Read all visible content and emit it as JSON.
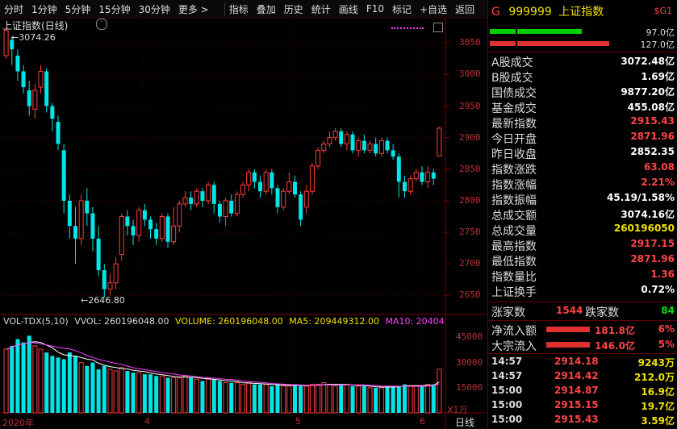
{
  "toolbar": {
    "items": [
      "分时",
      "1分钟",
      "5分钟",
      "15分钟",
      "30分钟",
      "更多 >",
      "指标",
      "叠加",
      "历史",
      "统计",
      "画线",
      "F10",
      "标记",
      "+自选",
      "返回"
    ]
  },
  "chart": {
    "title": "上证指数(日线)",
    "high_marker": "3074.26",
    "low_marker": "2646.80",
    "price_axis": [
      "3050",
      "3000",
      "2950",
      "2900",
      "2850",
      "2800",
      "2750",
      "2700",
      "2650"
    ],
    "vol_axis": [
      "45000",
      "30000",
      "15000"
    ],
    "vol_unit": "X1万",
    "date_labels": [
      "2020年",
      "4",
      "5",
      "6"
    ],
    "timeframe_button": "日线",
    "vol_header": {
      "indicator": "VOL-TDX(5,10)",
      "vvol": "VVOL: 260196048.00",
      "volume": "VOLUME: 260196048.00",
      "ma5": "MA5: 209449312.00",
      "ma10": "MA10: 20404"
    }
  },
  "chart_data": {
    "type": "candlestick",
    "title": "上证指数(日线)",
    "ylim": [
      2630,
      3090
    ],
    "candles": [
      [
        3030,
        3070,
        3025,
        3074
      ],
      [
        3055,
        3040,
        3015,
        3060
      ],
      [
        3030,
        3005,
        2990,
        3040
      ],
      [
        3005,
        2980,
        2970,
        3015
      ],
      [
        2975,
        2950,
        2935,
        2990
      ],
      [
        2945,
        2975,
        2930,
        2985
      ],
      [
        2980,
        3005,
        2970,
        3015
      ],
      [
        3005,
        2950,
        2940,
        3010
      ],
      [
        2950,
        2930,
        2910,
        2955
      ],
      [
        2925,
        2890,
        2880,
        2935
      ],
      [
        2880,
        2800,
        2780,
        2890
      ],
      [
        2800,
        2760,
        2740,
        2810
      ],
      [
        2760,
        2740,
        2700,
        2790
      ],
      [
        2740,
        2800,
        2730,
        2810
      ],
      [
        2800,
        2780,
        2760,
        2820
      ],
      [
        2780,
        2740,
        2720,
        2790
      ],
      [
        2740,
        2690,
        2680,
        2760
      ],
      [
        2690,
        2660,
        2646,
        2700
      ],
      [
        2660,
        2670,
        2650,
        2685
      ],
      [
        2670,
        2700,
        2660,
        2710
      ],
      [
        2715,
        2775,
        2705,
        2780
      ],
      [
        2775,
        2760,
        2745,
        2785
      ],
      [
        2760,
        2745,
        2730,
        2770
      ],
      [
        2745,
        2785,
        2735,
        2790
      ],
      [
        2785,
        2770,
        2760,
        2795
      ],
      [
        2770,
        2755,
        2740,
        2775
      ],
      [
        2755,
        2740,
        2730,
        2765
      ],
      [
        2740,
        2775,
        2735,
        2780
      ],
      [
        2775,
        2735,
        2725,
        2780
      ],
      [
        2735,
        2760,
        2730,
        2790
      ],
      [
        2760,
        2795,
        2750,
        2800
      ],
      [
        2795,
        2805,
        2790,
        2815
      ],
      [
        2805,
        2795,
        2785,
        2815
      ],
      [
        2795,
        2815,
        2790,
        2820
      ],
      [
        2815,
        2800,
        2790,
        2820
      ],
      [
        2800,
        2825,
        2795,
        2830
      ],
      [
        2825,
        2795,
        2780,
        2830
      ],
      [
        2795,
        2775,
        2765,
        2800
      ],
      [
        2775,
        2800,
        2760,
        2805
      ],
      [
        2800,
        2780,
        2775,
        2810
      ],
      [
        2780,
        2810,
        2775,
        2815
      ],
      [
        2810,
        2825,
        2805,
        2830
      ],
      [
        2825,
        2845,
        2815,
        2850
      ],
      [
        2845,
        2830,
        2820,
        2850
      ],
      [
        2830,
        2815,
        2805,
        2840
      ],
      [
        2815,
        2845,
        2810,
        2850
      ],
      [
        2845,
        2820,
        2810,
        2850
      ],
      [
        2820,
        2790,
        2780,
        2825
      ],
      [
        2790,
        2815,
        2785,
        2820
      ],
      [
        2815,
        2830,
        2810,
        2845
      ],
      [
        2830,
        2810,
        2805,
        2840
      ],
      [
        2810,
        2770,
        2760,
        2815
      ],
      [
        2790,
        2815,
        2780,
        2825
      ],
      [
        2815,
        2855,
        2810,
        2860
      ],
      [
        2855,
        2880,
        2850,
        2885
      ],
      [
        2880,
        2890,
        2875,
        2895
      ],
      [
        2890,
        2900,
        2885,
        2910
      ],
      [
        2900,
        2910,
        2895,
        2915
      ],
      [
        2910,
        2890,
        2885,
        2915
      ],
      [
        2890,
        2905,
        2880,
        2910
      ],
      [
        2905,
        2880,
        2875,
        2910
      ],
      [
        2880,
        2895,
        2870,
        2900
      ],
      [
        2895,
        2880,
        2875,
        2905
      ],
      [
        2880,
        2890,
        2875,
        2895
      ],
      [
        2890,
        2875,
        2870,
        2900
      ],
      [
        2875,
        2895,
        2870,
        2900
      ],
      [
        2895,
        2880,
        2875,
        2900
      ],
      [
        2880,
        2870,
        2865,
        2890
      ],
      [
        2870,
        2830,
        2805,
        2875
      ],
      [
        2830,
        2815,
        2805,
        2840
      ],
      [
        2815,
        2835,
        2810,
        2840
      ],
      [
        2835,
        2845,
        2830,
        2850
      ],
      [
        2845,
        2830,
        2825,
        2855
      ],
      [
        2830,
        2845,
        2820,
        2855
      ],
      [
        2845,
        2835,
        2825,
        2850
      ],
      [
        2871,
        2915,
        2871,
        2917
      ]
    ],
    "volumes": [
      38,
      40,
      44,
      42,
      46,
      40,
      38,
      36,
      34,
      33,
      32,
      36,
      34,
      30,
      28,
      30,
      26,
      28,
      26,
      25,
      27,
      25,
      24,
      24,
      23,
      23,
      22,
      22,
      21,
      21,
      21,
      22,
      21,
      20,
      19,
      20,
      20,
      19,
      18,
      18,
      18,
      17,
      18,
      17,
      17,
      17,
      16,
      17,
      16,
      16,
      17,
      16,
      16,
      17,
      17,
      18,
      17,
      16,
      17,
      17,
      16,
      16,
      16,
      15,
      15,
      15,
      16,
      16,
      16,
      17,
      16,
      16,
      16,
      17,
      17,
      26
    ]
  },
  "panel": {
    "header": {
      "code_prefix": "G",
      "code": "999999",
      "name": "上证指数",
      "tag": "$G1"
    },
    "bar_up_value": "97.0亿",
    "bar_down_value": "127.0亿",
    "stats": [
      {
        "k": "A股成交",
        "v": "3072.48亿",
        "c": "white"
      },
      {
        "k": "B股成交",
        "v": "1.69亿",
        "c": "white"
      },
      {
        "k": "国债成交",
        "v": "9877.20亿",
        "c": "white"
      },
      {
        "k": "基金成交",
        "v": "455.08亿",
        "c": "white"
      },
      {
        "k": "最新指数",
        "v": "2915.43",
        "c": "red"
      },
      {
        "k": "今日开盘",
        "v": "2871.96",
        "c": "red"
      },
      {
        "k": "昨日收盘",
        "v": "2852.35",
        "c": "white"
      },
      {
        "k": "指数涨跌",
        "v": "63.08",
        "c": "red"
      },
      {
        "k": "指数涨幅",
        "v": "2.21%",
        "c": "red"
      },
      {
        "k": "指数振幅",
        "v": "45.19/1.58%",
        "c": "white"
      },
      {
        "k": "总成交额",
        "v": "3074.16亿",
        "c": "white"
      },
      {
        "k": "总成交量",
        "v": "260196050",
        "c": "yellow"
      },
      {
        "k": "最高指数",
        "v": "2917.15",
        "c": "red"
      },
      {
        "k": "最低指数",
        "v": "2871.96",
        "c": "red"
      },
      {
        "k": "指数量比",
        "v": "1.36",
        "c": "red"
      },
      {
        "k": "上证换手",
        "v": "0.72%",
        "c": "white"
      }
    ],
    "rise_label": "涨家数",
    "rise_count": "1544",
    "fall_label": "跌家数",
    "fall_count": "84",
    "flows": [
      {
        "k": "净流入额",
        "v": "181.8亿",
        "pct": "6%"
      },
      {
        "k": "大宗流入",
        "v": "146.0亿",
        "pct": "5%"
      }
    ],
    "ticks": [
      {
        "t": "14:57",
        "p": "2914.18",
        "vol": "9243万"
      },
      {
        "t": "14:57",
        "p": "2914.42",
        "vol": "212.0万"
      },
      {
        "t": "15:00",
        "p": "2914.87",
        "vol": "16.9亿"
      },
      {
        "t": "15:00",
        "p": "2915.15",
        "vol": "19.7亿"
      },
      {
        "t": "15:00",
        "p": "2915.43",
        "vol": "3.59亿"
      }
    ]
  },
  "colors": {
    "up": "#ff3c3c",
    "down": "#00e5e5",
    "ma5": "#ffffff",
    "ma10": "#ff40ff"
  }
}
